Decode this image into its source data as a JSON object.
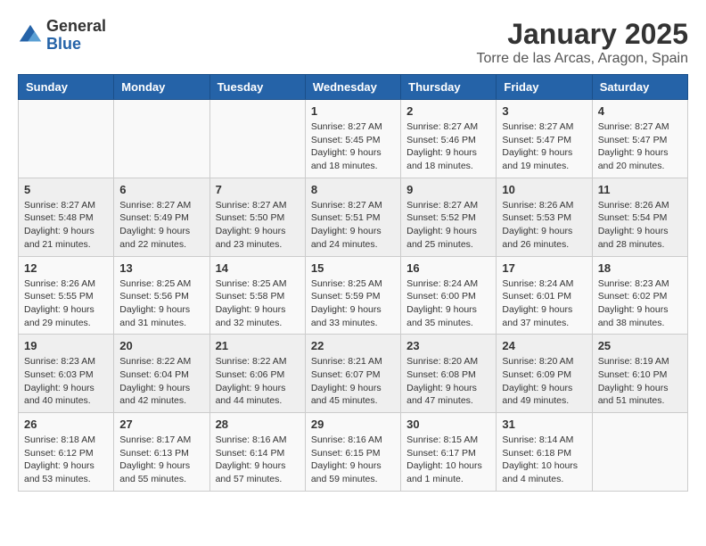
{
  "logo": {
    "general": "General",
    "blue": "Blue"
  },
  "header": {
    "title": "January 2025",
    "subtitle": "Torre de las Arcas, Aragon, Spain"
  },
  "days_of_week": [
    "Sunday",
    "Monday",
    "Tuesday",
    "Wednesday",
    "Thursday",
    "Friday",
    "Saturday"
  ],
  "weeks": [
    [
      {
        "day": "",
        "info": ""
      },
      {
        "day": "",
        "info": ""
      },
      {
        "day": "",
        "info": ""
      },
      {
        "day": "1",
        "info": "Sunrise: 8:27 AM\nSunset: 5:45 PM\nDaylight: 9 hours and 18 minutes."
      },
      {
        "day": "2",
        "info": "Sunrise: 8:27 AM\nSunset: 5:46 PM\nDaylight: 9 hours and 18 minutes."
      },
      {
        "day": "3",
        "info": "Sunrise: 8:27 AM\nSunset: 5:47 PM\nDaylight: 9 hours and 19 minutes."
      },
      {
        "day": "4",
        "info": "Sunrise: 8:27 AM\nSunset: 5:47 PM\nDaylight: 9 hours and 20 minutes."
      }
    ],
    [
      {
        "day": "5",
        "info": "Sunrise: 8:27 AM\nSunset: 5:48 PM\nDaylight: 9 hours and 21 minutes."
      },
      {
        "day": "6",
        "info": "Sunrise: 8:27 AM\nSunset: 5:49 PM\nDaylight: 9 hours and 22 minutes."
      },
      {
        "day": "7",
        "info": "Sunrise: 8:27 AM\nSunset: 5:50 PM\nDaylight: 9 hours and 23 minutes."
      },
      {
        "day": "8",
        "info": "Sunrise: 8:27 AM\nSunset: 5:51 PM\nDaylight: 9 hours and 24 minutes."
      },
      {
        "day": "9",
        "info": "Sunrise: 8:27 AM\nSunset: 5:52 PM\nDaylight: 9 hours and 25 minutes."
      },
      {
        "day": "10",
        "info": "Sunrise: 8:26 AM\nSunset: 5:53 PM\nDaylight: 9 hours and 26 minutes."
      },
      {
        "day": "11",
        "info": "Sunrise: 8:26 AM\nSunset: 5:54 PM\nDaylight: 9 hours and 28 minutes."
      }
    ],
    [
      {
        "day": "12",
        "info": "Sunrise: 8:26 AM\nSunset: 5:55 PM\nDaylight: 9 hours and 29 minutes."
      },
      {
        "day": "13",
        "info": "Sunrise: 8:25 AM\nSunset: 5:56 PM\nDaylight: 9 hours and 31 minutes."
      },
      {
        "day": "14",
        "info": "Sunrise: 8:25 AM\nSunset: 5:58 PM\nDaylight: 9 hours and 32 minutes."
      },
      {
        "day": "15",
        "info": "Sunrise: 8:25 AM\nSunset: 5:59 PM\nDaylight: 9 hours and 33 minutes."
      },
      {
        "day": "16",
        "info": "Sunrise: 8:24 AM\nSunset: 6:00 PM\nDaylight: 9 hours and 35 minutes."
      },
      {
        "day": "17",
        "info": "Sunrise: 8:24 AM\nSunset: 6:01 PM\nDaylight: 9 hours and 37 minutes."
      },
      {
        "day": "18",
        "info": "Sunrise: 8:23 AM\nSunset: 6:02 PM\nDaylight: 9 hours and 38 minutes."
      }
    ],
    [
      {
        "day": "19",
        "info": "Sunrise: 8:23 AM\nSunset: 6:03 PM\nDaylight: 9 hours and 40 minutes."
      },
      {
        "day": "20",
        "info": "Sunrise: 8:22 AM\nSunset: 6:04 PM\nDaylight: 9 hours and 42 minutes."
      },
      {
        "day": "21",
        "info": "Sunrise: 8:22 AM\nSunset: 6:06 PM\nDaylight: 9 hours and 44 minutes."
      },
      {
        "day": "22",
        "info": "Sunrise: 8:21 AM\nSunset: 6:07 PM\nDaylight: 9 hours and 45 minutes."
      },
      {
        "day": "23",
        "info": "Sunrise: 8:20 AM\nSunset: 6:08 PM\nDaylight: 9 hours and 47 minutes."
      },
      {
        "day": "24",
        "info": "Sunrise: 8:20 AM\nSunset: 6:09 PM\nDaylight: 9 hours and 49 minutes."
      },
      {
        "day": "25",
        "info": "Sunrise: 8:19 AM\nSunset: 6:10 PM\nDaylight: 9 hours and 51 minutes."
      }
    ],
    [
      {
        "day": "26",
        "info": "Sunrise: 8:18 AM\nSunset: 6:12 PM\nDaylight: 9 hours and 53 minutes."
      },
      {
        "day": "27",
        "info": "Sunrise: 8:17 AM\nSunset: 6:13 PM\nDaylight: 9 hours and 55 minutes."
      },
      {
        "day": "28",
        "info": "Sunrise: 8:16 AM\nSunset: 6:14 PM\nDaylight: 9 hours and 57 minutes."
      },
      {
        "day": "29",
        "info": "Sunrise: 8:16 AM\nSunset: 6:15 PM\nDaylight: 9 hours and 59 minutes."
      },
      {
        "day": "30",
        "info": "Sunrise: 8:15 AM\nSunset: 6:17 PM\nDaylight: 10 hours and 1 minute."
      },
      {
        "day": "31",
        "info": "Sunrise: 8:14 AM\nSunset: 6:18 PM\nDaylight: 10 hours and 4 minutes."
      },
      {
        "day": "",
        "info": ""
      }
    ]
  ]
}
